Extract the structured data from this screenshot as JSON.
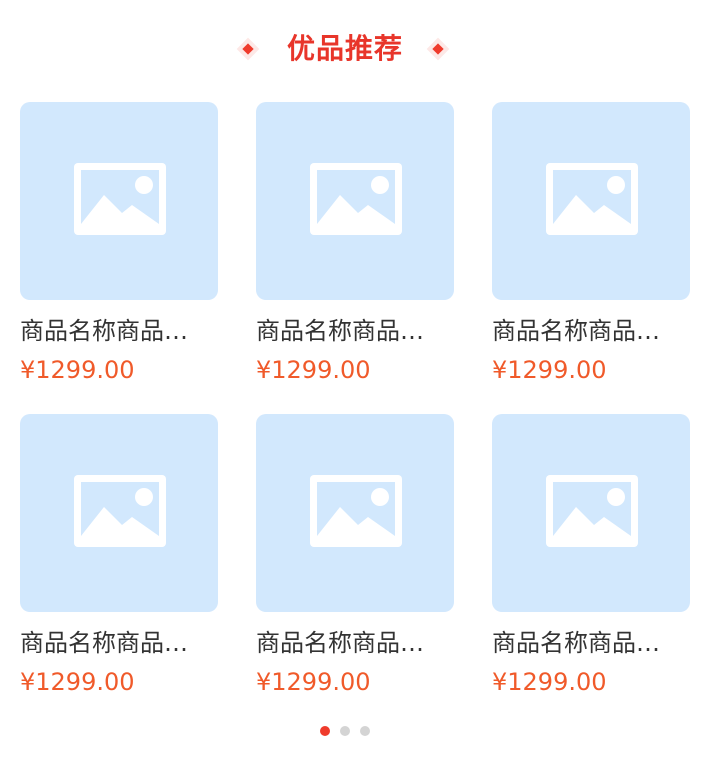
{
  "section": {
    "title": "优品推荐"
  },
  "colors": {
    "accent": "#E8352A",
    "price": "#F05A2A",
    "placeholder_bg": "#D2E8FD",
    "dot_active": "#EF3B2C",
    "dot_inactive": "#D4D4D4"
  },
  "products": [
    {
      "name": "商品名称商品…",
      "price": "¥1299.00",
      "image_icon": "image-placeholder-icon"
    },
    {
      "name": "商品名称商品…",
      "price": "¥1299.00",
      "image_icon": "image-placeholder-icon"
    },
    {
      "name": "商品名称商品…",
      "price": "¥1299.00",
      "image_icon": "image-placeholder-icon"
    },
    {
      "name": "商品名称商品…",
      "price": "¥1299.00",
      "image_icon": "image-placeholder-icon"
    },
    {
      "name": "商品名称商品…",
      "price": "¥1299.00",
      "image_icon": "image-placeholder-icon"
    },
    {
      "name": "商品名称商品…",
      "price": "¥1299.00",
      "image_icon": "image-placeholder-icon"
    }
  ],
  "pagination": {
    "pages": 3,
    "active": 1
  }
}
